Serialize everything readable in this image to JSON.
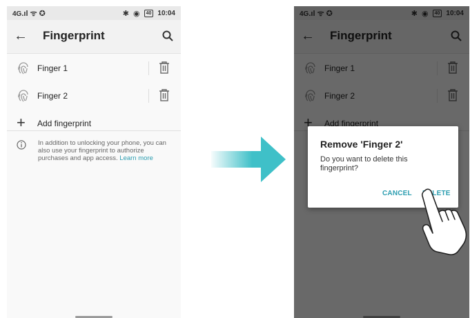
{
  "status_bar": {
    "signal": "4G",
    "time": "10:04",
    "battery": "40"
  },
  "app_bar": {
    "title": "Fingerprint"
  },
  "fingerprints": [
    {
      "label": "Finger 1"
    },
    {
      "label": "Finger 2"
    }
  ],
  "add_fingerprint": {
    "label": "Add fingerprint"
  },
  "info": {
    "text": "In addition to unlocking your phone, you can also use your fingerprint to authorize purchases and app access.",
    "link": "Learn more"
  },
  "dialog": {
    "title": "Remove 'Finger 2'",
    "message": "Do you want to delete this fingerprint?",
    "cancel": "CANCEL",
    "delete": "DELETE"
  },
  "colors": {
    "accent": "#2b9db0",
    "arrow": "#3fc0c8",
    "scrim": "#000000"
  },
  "icons": [
    "back-arrow-icon",
    "search-icon",
    "fingerprint-icon",
    "trash-icon",
    "plus-icon",
    "info-icon",
    "hand-pointer-icon"
  ]
}
